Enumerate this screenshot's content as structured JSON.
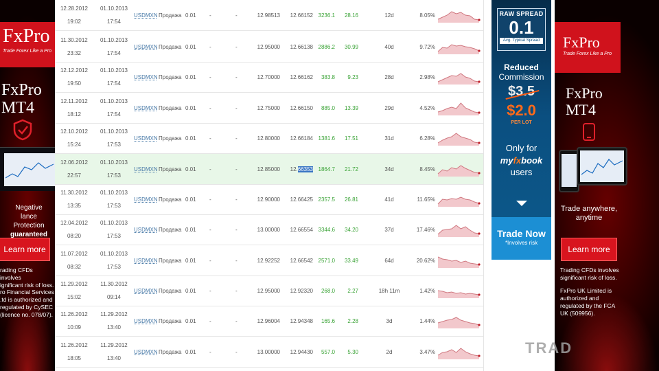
{
  "ad_left": {
    "logo_name": "FxPro",
    "logo_tag": "Trade Forex Like a Pro",
    "mt4_line1": "FxPro",
    "mt4_line2": "MT4",
    "promo_line1": "Negative",
    "promo_line2": "lance Protection",
    "promo_line3": "guaranteed",
    "button": "Learn more",
    "risk_line1": "rading CFDs involves",
    "risk_line2": "ignificant risk of loss.",
    "reg_line1": "ro Financial Services",
    "reg_line2": ".td is authorized and",
    "reg_line3": "regulated by CySEC",
    "reg_line4": "(licence no. 078/07)."
  },
  "ad_right": {
    "logo_name": "FxPro",
    "logo_tag": "Trade Forex Like a Pro",
    "mt4_line1": "FxPro",
    "mt4_line2": "MT4",
    "tagline1": "Trade anywhere,",
    "tagline2": "anytime",
    "button": "Learn more",
    "risk_line1": "Trading CFDs involves",
    "risk_line2": "significant risk of loss.",
    "reg_line1": "FxPro UK Limited is",
    "reg_line2": "authorized and",
    "reg_line3": "regulated by the FCA",
    "reg_line4": "UK (509956)."
  },
  "mfx_ad": {
    "raw_title": "RAW SPREAD",
    "raw_value": "0.1",
    "raw_sub": "Avg. Typical Spread",
    "reduced": "Reduced",
    "commission": "Commission",
    "old_price": "$3.5",
    "new_price": "$2.0",
    "per_lot": "PER LOT",
    "only_for": "Only for",
    "brand_my": "my",
    "brand_fx": "fx",
    "brand_book": "book",
    "users": "users",
    "trade_now": "Trade Now",
    "involves_risk": "*Involves risk"
  },
  "watermark": "TRAD",
  "trades": [
    {
      "open_date": "12.28.2012",
      "open_time": "19:02",
      "close_date": "01.10.2013",
      "close_time": "17:54",
      "symbol": "USDMXN",
      "action": "Продажа",
      "lots": "0.01",
      "sl": "-",
      "tp": "-",
      "open_price": "12.98513",
      "close_price": "12.66152",
      "pips": "3236.1",
      "profit": "28.16",
      "duration": "12d",
      "gain": "8.05%",
      "spark": [
        0.85,
        0.7,
        0.55,
        0.3,
        0.45,
        0.35,
        0.55,
        0.6,
        0.85,
        0.9
      ]
    },
    {
      "open_date": "11.30.2012",
      "open_time": "23:32",
      "close_date": "01.10.2013",
      "close_time": "17:54",
      "symbol": "USDMXN",
      "action": "Продажа",
      "lots": "0.01",
      "sl": "-",
      "tp": "-",
      "open_price": "12.95000",
      "close_price": "12.66138",
      "pips": "2886.2",
      "profit": "30.99",
      "duration": "40d",
      "gain": "9.72%",
      "spark": [
        0.9,
        0.6,
        0.65,
        0.4,
        0.5,
        0.45,
        0.55,
        0.6,
        0.7,
        0.85
      ]
    },
    {
      "open_date": "12.12.2012",
      "open_time": "19:50",
      "close_date": "01.10.2013",
      "close_time": "17:54",
      "symbol": "USDMXN",
      "action": "Продажа",
      "lots": "0.01",
      "sl": "-",
      "tp": "-",
      "open_price": "12.70000",
      "close_price": "12.66162",
      "pips": "383.8",
      "profit": "9.23",
      "duration": "28d",
      "gain": "2.98%",
      "spark": [
        0.9,
        0.75,
        0.6,
        0.45,
        0.5,
        0.3,
        0.55,
        0.65,
        0.85,
        0.9
      ]
    },
    {
      "open_date": "12.11.2012",
      "open_time": "18:12",
      "close_date": "01.10.2013",
      "close_time": "17:54",
      "symbol": "USDMXN",
      "action": "Продажа",
      "lots": "0.01",
      "sl": "-",
      "tp": "-",
      "open_price": "12.75000",
      "close_price": "12.66150",
      "pips": "885.0",
      "profit": "13.39",
      "duration": "29d",
      "gain": "4.52%",
      "spark": [
        0.85,
        0.75,
        0.6,
        0.5,
        0.6,
        0.2,
        0.55,
        0.7,
        0.85,
        0.9
      ]
    },
    {
      "open_date": "12.10.2012",
      "open_time": "15:24",
      "close_date": "01.10.2013",
      "close_time": "17:53",
      "symbol": "USDMXN",
      "action": "Продажа",
      "lots": "0.01",
      "sl": "-",
      "tp": "-",
      "open_price": "12.80000",
      "close_price": "12.66184",
      "pips": "1381.6",
      "profit": "17.51",
      "duration": "31d",
      "gain": "6.28%",
      "spark": [
        0.9,
        0.7,
        0.55,
        0.45,
        0.2,
        0.45,
        0.55,
        0.65,
        0.85,
        0.9
      ]
    },
    {
      "open_date": "12.06.2012",
      "open_time": "22:57",
      "close_date": "01.10.2013",
      "close_time": "17:53",
      "symbol": "USDMXN",
      "action": "Продажа",
      "lots": "0.01",
      "sl": "-",
      "tp": "-",
      "open_price": "12.85000",
      "close_price": "12.66353",
      "pips": "1864.7",
      "profit": "21.72",
      "duration": "34d",
      "gain": "8.45%",
      "spark": [
        0.9,
        0.6,
        0.7,
        0.45,
        0.55,
        0.3,
        0.5,
        0.65,
        0.8,
        0.85
      ]
    },
    {
      "open_date": "11.30.2012",
      "open_time": "13:35",
      "close_date": "01.10.2013",
      "close_time": "17:53",
      "symbol": "USDMXN",
      "action": "Продажа",
      "lots": "0.01",
      "sl": "-",
      "tp": "-",
      "open_price": "12.90000",
      "close_price": "12.66425",
      "pips": "2357.5",
      "profit": "26.81",
      "duration": "41d",
      "gain": "11.65%",
      "spark": [
        0.9,
        0.55,
        0.6,
        0.5,
        0.55,
        0.4,
        0.55,
        0.6,
        0.75,
        0.85
      ]
    },
    {
      "open_date": "12.04.2012",
      "open_time": "08:20",
      "close_date": "01.10.2013",
      "close_time": "17:53",
      "symbol": "USDMXN",
      "action": "Продажа",
      "lots": "0.01",
      "sl": "-",
      "tp": "-",
      "open_price": "13.00000",
      "close_price": "12.66554",
      "pips": "3344.6",
      "profit": "34.20",
      "duration": "37d",
      "gain": "17.46%",
      "spark": [
        0.9,
        0.6,
        0.55,
        0.5,
        0.25,
        0.5,
        0.35,
        0.6,
        0.8,
        0.85
      ]
    },
    {
      "open_date": "11.07.2012",
      "open_time": "08:32",
      "close_date": "01.10.2013",
      "close_time": "17:53",
      "symbol": "USDMXN",
      "action": "Продажа",
      "lots": "0.01",
      "sl": "-",
      "tp": "-",
      "open_price": "12.92252",
      "close_price": "12.66542",
      "pips": "2571.0",
      "profit": "33.49",
      "duration": "64d",
      "gain": "20.62%",
      "spark": [
        0.3,
        0.45,
        0.5,
        0.6,
        0.55,
        0.7,
        0.6,
        0.75,
        0.8,
        0.85
      ]
    },
    {
      "open_date": "11.29.2012",
      "open_time": "15:02",
      "close_date": "11.30.2012",
      "close_time": "09:14",
      "symbol": "USDMXN",
      "action": "Продажа",
      "lots": "0.01",
      "sl": "-",
      "tp": "-",
      "open_price": "12.95000",
      "close_price": "12.92320",
      "pips": "268.0",
      "profit": "2.27",
      "duration": "18h 11m",
      "gain": "1.42%",
      "spark": [
        0.55,
        0.6,
        0.7,
        0.65,
        0.75,
        0.7,
        0.8,
        0.75,
        0.8,
        0.85
      ]
    },
    {
      "open_date": "11.26.2012",
      "open_time": "10:09",
      "close_date": "11.29.2012",
      "close_time": "13:40",
      "symbol": "USDMXN",
      "action": "Продажа",
      "lots": "0.01",
      "sl": "-",
      "tp": "-",
      "open_price": "12.96004",
      "close_price": "12.94348",
      "pips": "165.6",
      "profit": "2.28",
      "duration": "3d",
      "gain": "1.44%",
      "spark": [
        0.7,
        0.6,
        0.5,
        0.45,
        0.3,
        0.5,
        0.6,
        0.7,
        0.75,
        0.85
      ]
    },
    {
      "open_date": "11.26.2012",
      "open_time": "18:05",
      "close_date": "11.29.2012",
      "close_time": "13:40",
      "symbol": "USDMXN",
      "action": "Продажа",
      "lots": "0.01",
      "sl": "-",
      "tp": "-",
      "open_price": "13.00000",
      "close_price": "12.94430",
      "pips": "557.0",
      "profit": "5.30",
      "duration": "2d",
      "gain": "3.47%",
      "spark": [
        0.8,
        0.6,
        0.55,
        0.4,
        0.6,
        0.3,
        0.55,
        0.7,
        0.8,
        0.85
      ]
    }
  ],
  "highlight_row": 5,
  "selected_text": {
    "row": 5,
    "prefix": "12.",
    "selected": "66353"
  }
}
